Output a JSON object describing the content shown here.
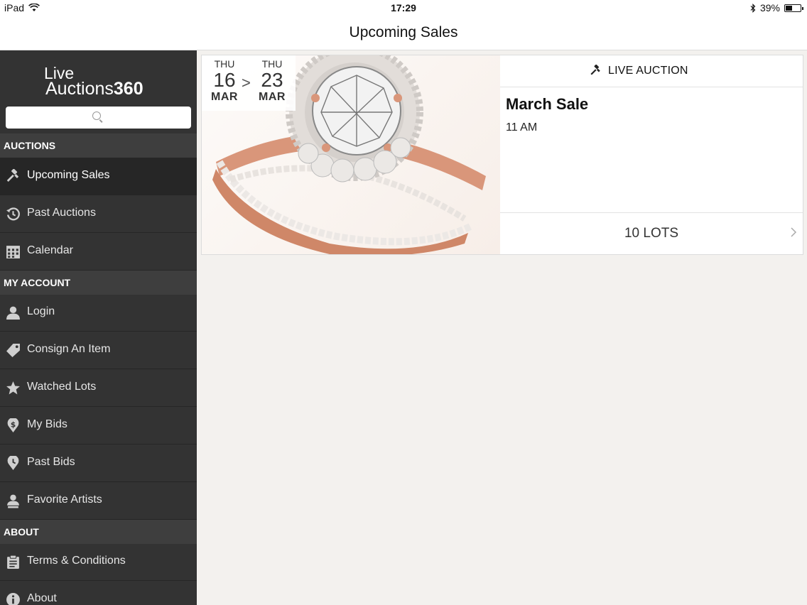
{
  "status_bar": {
    "device": "iPad",
    "time": "17:29",
    "battery": "39%"
  },
  "nav": {
    "title": "Upcoming Sales"
  },
  "logo": {
    "line1": "Live",
    "line2_a": "Auctions",
    "line2_b": "360"
  },
  "search": {
    "placeholder": ""
  },
  "sidebar": {
    "sections": {
      "auctions": "AUCTIONS",
      "my_account": "MY ACCOUNT",
      "about": "ABOUT"
    },
    "items": [
      {
        "label": "Upcoming Sales",
        "icon": "gavel-icon",
        "active": true
      },
      {
        "label": "Past Auctions",
        "icon": "history-icon"
      },
      {
        "label": "Calendar",
        "icon": "calendar-icon"
      },
      {
        "label": "Login",
        "icon": "user-icon"
      },
      {
        "label": "Consign An Item",
        "icon": "tag-icon"
      },
      {
        "label": "Watched Lots",
        "icon": "star-icon"
      },
      {
        "label": "My Bids",
        "icon": "dollar-pin-icon"
      },
      {
        "label": "Past Bids",
        "icon": "clock-pin-icon"
      },
      {
        "label": "Favorite Artists",
        "icon": "artist-icon"
      },
      {
        "label": "Terms & Conditions",
        "icon": "clipboard-icon"
      },
      {
        "label": "About",
        "icon": "info-icon"
      }
    ]
  },
  "sale_card": {
    "start": {
      "dow": "THU",
      "day": "16",
      "mon": "MAR"
    },
    "end": {
      "dow": "THU",
      "day": "23",
      "mon": "MAR"
    },
    "arrow": ">",
    "type_label": "LIVE AUCTION",
    "title": "March Sale",
    "time": "11 AM",
    "lots": "10 LOTS"
  },
  "colors": {
    "sidebar_bg": "#333333",
    "sidebar_active": "#262626",
    "section_bg": "#3e3e3e",
    "content_bg": "#f3f1ee",
    "ring_gold": "#d9967a"
  }
}
